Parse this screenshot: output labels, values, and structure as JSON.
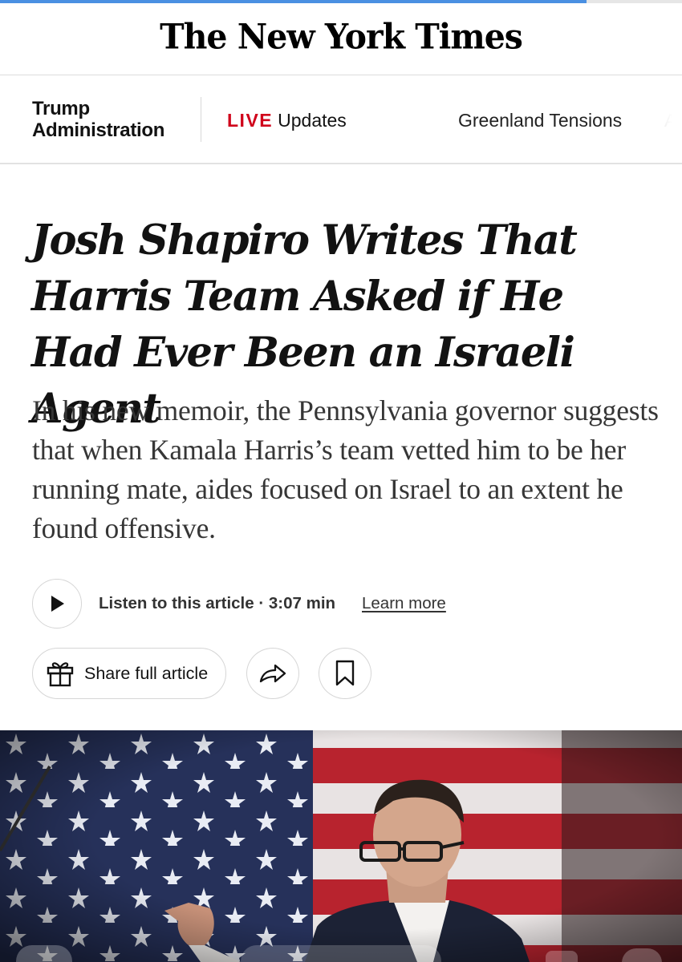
{
  "browser": {
    "load_progress": 0.86
  },
  "masthead": {
    "logo_text": "The New York Times"
  },
  "section_nav": {
    "section_title_line1": "Trump",
    "section_title_line2": "Administration",
    "live_label": "LIVE",
    "live_text": "Updates",
    "links": [
      "Greenland Tensions",
      "Ar"
    ]
  },
  "article": {
    "headline": "Josh Shapiro Writes That Harris Team Asked if He Had Ever Been an Israeli Agent",
    "summary": "In his new memoir, the Pennsylvania governor suggests that when Kamala Harris’s team vetted him to be her running mate, aides focused on Israel to an extent he found offensive.",
    "listen_label": "Listen to this article · 3:07 min",
    "learn_more": "Learn more",
    "share_full_label": "Share full article"
  },
  "icons": {
    "play": "play-icon",
    "gift": "gift-icon",
    "share": "share-arrow-icon",
    "bookmark": "bookmark-icon"
  },
  "colors": {
    "live_red": "#d0021b",
    "text": "#121212",
    "summary_text": "#363636",
    "progress_blue": "#4a90e2"
  }
}
